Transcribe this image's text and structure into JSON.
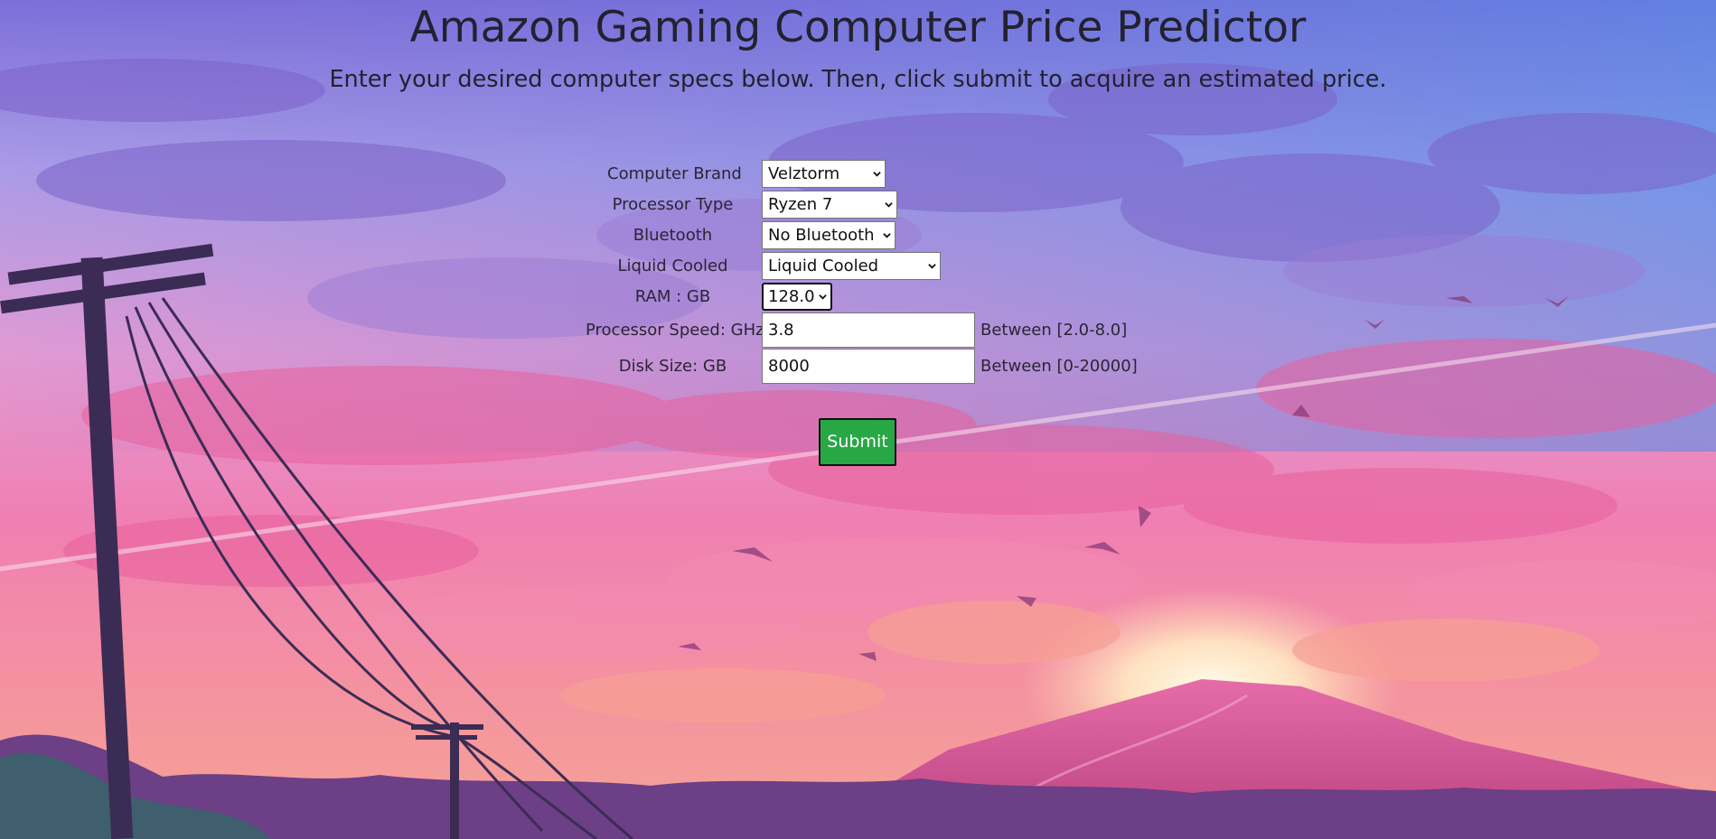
{
  "header": {
    "title": "Amazon Gaming Computer Price Predictor",
    "subtitle": "Enter your desired computer specs below. Then, click submit to acquire an estimated price."
  },
  "form": {
    "brand": {
      "label": "Computer Brand",
      "value": "Velztorm"
    },
    "processor_type": {
      "label": "Processor Type",
      "value": "Ryzen 7"
    },
    "bluetooth": {
      "label": "Bluetooth",
      "value": "No Bluetooth"
    },
    "liquid_cooled": {
      "label": "Liquid Cooled",
      "value": "Liquid Cooled"
    },
    "ram": {
      "label": "RAM : GB",
      "value": "128.0"
    },
    "processor_speed": {
      "label": "Processor Speed: GHz",
      "value": "3.8",
      "hint": "Between [2.0-8.0]"
    },
    "disk_size": {
      "label": "Disk Size: GB",
      "value": "8000",
      "hint": "Between [0-20000]"
    },
    "submit_label": "Submit"
  },
  "icons": {
    "select_arrow": "chevron-down-icon"
  },
  "colors": {
    "submit_button": "#28a745",
    "sky_top": "#7e6fd8",
    "sky_bottom": "#f27aa6"
  }
}
